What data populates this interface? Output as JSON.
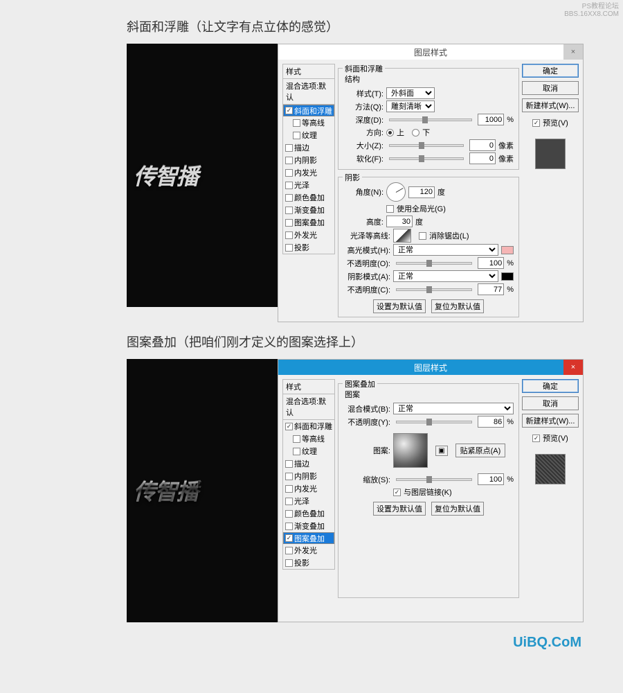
{
  "watermark_top": {
    "line1": "PS教程论坛",
    "line2": "BBS.16XX8.COM"
  },
  "watermark_bottom": "UiBQ.CoM",
  "caption1": "斜面和浮雕（让文字有点立体的感觉）",
  "caption2": "图案叠加（把咱们刚才定义的图案选择上）",
  "canvas_text": "传智播",
  "dialog_title": "图层样式",
  "styles": {
    "header": "样式",
    "blend_default": "混合选项:默认",
    "items": [
      {
        "label": "斜面和浮雕",
        "indent": false
      },
      {
        "label": "等高线",
        "indent": true
      },
      {
        "label": "纹理",
        "indent": true
      },
      {
        "label": "描边",
        "indent": false
      },
      {
        "label": "内阴影",
        "indent": false
      },
      {
        "label": "内发光",
        "indent": false
      },
      {
        "label": "光泽",
        "indent": false
      },
      {
        "label": "颜色叠加",
        "indent": false
      },
      {
        "label": "渐变叠加",
        "indent": false
      },
      {
        "label": "图案叠加",
        "indent": false
      },
      {
        "label": "外发光",
        "indent": false
      },
      {
        "label": "投影",
        "indent": false
      }
    ]
  },
  "bevel": {
    "group": "斜面和浮雕",
    "struct": "结构",
    "style_label": "样式(T):",
    "style_val": "外斜面",
    "tech_label": "方法(Q):",
    "tech_val": "雕刻清晰",
    "depth_label": "深度(D):",
    "depth_val": "1000",
    "pct": "%",
    "dir_label": "方向:",
    "up": "上",
    "down": "下",
    "size_label": "大小(Z):",
    "size_val": "0",
    "px": "像素",
    "soften_label": "软化(F):",
    "soften_val": "0",
    "shading": "阴影",
    "angle_label": "角度(N):",
    "angle_val": "120",
    "deg": "度",
    "global_label": "使用全局光(G)",
    "alt_label": "高度:",
    "alt_val": "30",
    "gloss_label": "光泽等高线:",
    "anti_label": "消除锯齿(L)",
    "hl_mode_label": "高光模式(H):",
    "hl_mode_val": "正常",
    "hl_op_label": "不透明度(O):",
    "hl_op_val": "100",
    "sh_mode_label": "阴影模式(A):",
    "sh_mode_val": "正常",
    "sh_op_label": "不透明度(C):",
    "sh_op_val": "77",
    "btn_default": "设置为默认值",
    "btn_reset": "复位为默认值"
  },
  "pattern": {
    "group": "图案叠加",
    "sub": "图案",
    "mode_label": "混合模式(B):",
    "mode_val": "正常",
    "op_label": "不透明度(Y):",
    "op_val": "86",
    "pct": "%",
    "pat_label": "图案:",
    "snap_label": "贴紧原点(A)",
    "scale_label": "缩放(S):",
    "scale_val": "100",
    "link_label": "与图层链接(K)",
    "btn_default": "设置为默认值",
    "btn_reset": "复位为默认值"
  },
  "buttons": {
    "ok": "确定",
    "cancel": "取消",
    "new_style": "新建样式(W)...",
    "preview": "预览(V)"
  }
}
